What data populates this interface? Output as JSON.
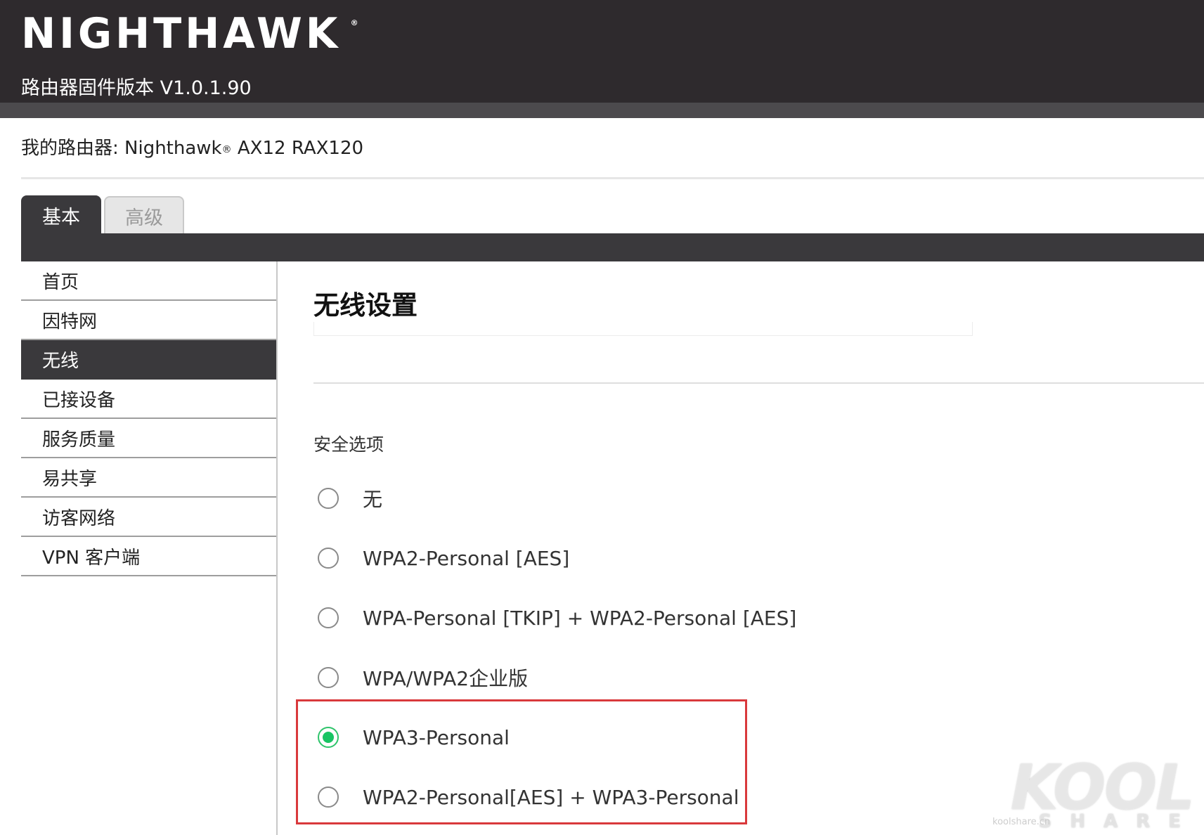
{
  "header": {
    "logo_text": "NIGHTHAWK",
    "logo_mark": "®",
    "firmware_label": "路由器固件版本 V1.0.1.90"
  },
  "router": {
    "label": "我的路由器: Nighthawk",
    "mark": "®",
    "model": " AX12 RAX120"
  },
  "tabs": [
    {
      "label": "基本",
      "active": true
    },
    {
      "label": "高级",
      "active": false
    }
  ],
  "sidebar": {
    "items": [
      {
        "label": "首页"
      },
      {
        "label": "因特网"
      },
      {
        "label": "无线",
        "active": true
      },
      {
        "label": "已接设备"
      },
      {
        "label": "服务质量"
      },
      {
        "label": "易共享"
      },
      {
        "label": "访客网络"
      },
      {
        "label": "VPN 客户端"
      }
    ]
  },
  "main": {
    "title": "无线设置",
    "section_label": "安全选项",
    "options": [
      {
        "label": "无",
        "checked": false
      },
      {
        "label": "WPA2-Personal [AES]",
        "checked": false
      },
      {
        "label": "WPA-Personal [TKIP] + WPA2-Personal [AES]",
        "checked": false
      },
      {
        "label": "WPA/WPA2企业版",
        "checked": false
      },
      {
        "label": "WPA3-Personal",
        "checked": true
      },
      {
        "label": "WPA2-Personal[AES] + WPA3-Personal",
        "checked": false
      }
    ],
    "highlight_color": "#d9393c",
    "radio_accent": "#18c463"
  },
  "watermark": {
    "brand": "KOOL",
    "sub": "SHARE",
    "site": "koolshare.cn"
  }
}
